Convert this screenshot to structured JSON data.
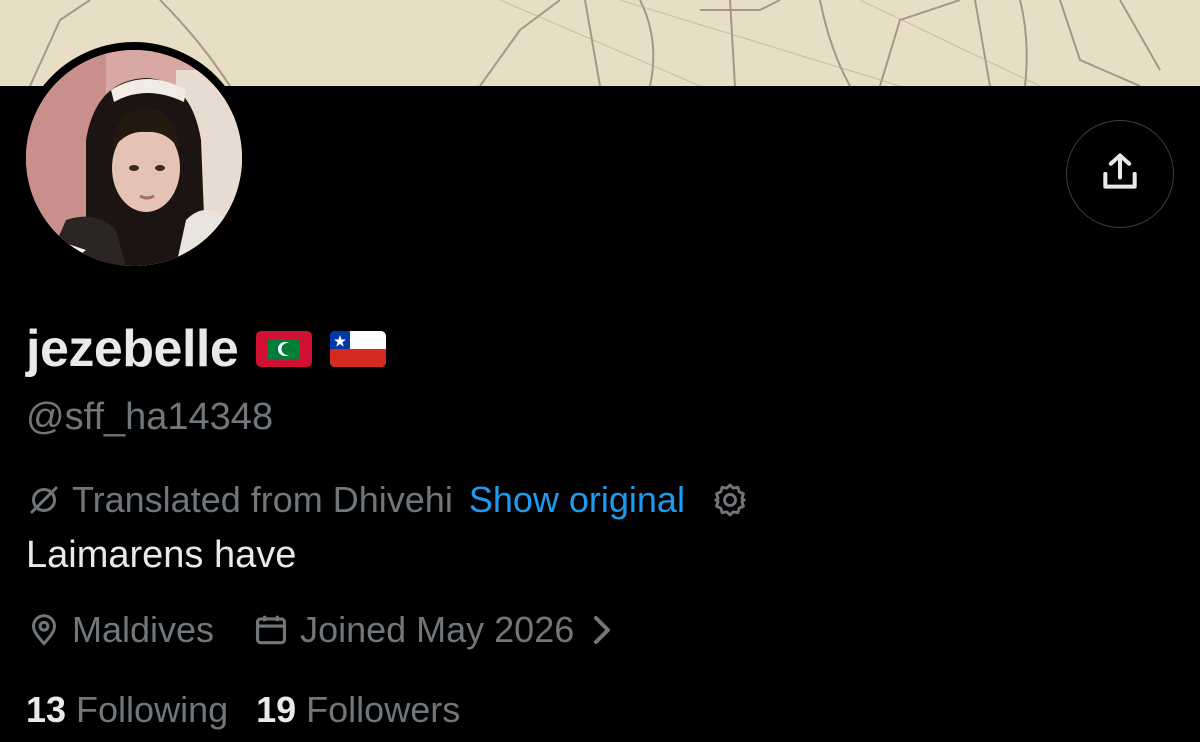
{
  "profile": {
    "display_name": "jezebelle",
    "handle": "@sff_ha14348",
    "name_flags": [
      "maldives-flag",
      "chile-flag"
    ]
  },
  "translation": {
    "text": "Translated from Dhivehi",
    "show_original": "Show original"
  },
  "bio": "Laimarens have",
  "meta": {
    "location": "Maldives",
    "joined": "Joined May 2026"
  },
  "stats": {
    "following_count": "13",
    "following_label": "Following",
    "followers_count": "19",
    "followers_label": "Followers"
  },
  "icons": {
    "share": "share-icon",
    "translate": "translate-slash-icon",
    "settings": "gear-icon",
    "location": "location-pin-icon",
    "calendar": "calendar-icon",
    "chevron": "chevron-right-icon"
  },
  "colors": {
    "background": "#000000",
    "text_primary": "#e7e9ea",
    "text_secondary": "#71767b",
    "link": "#1d9bf0",
    "banner": "#e6dcc3"
  }
}
